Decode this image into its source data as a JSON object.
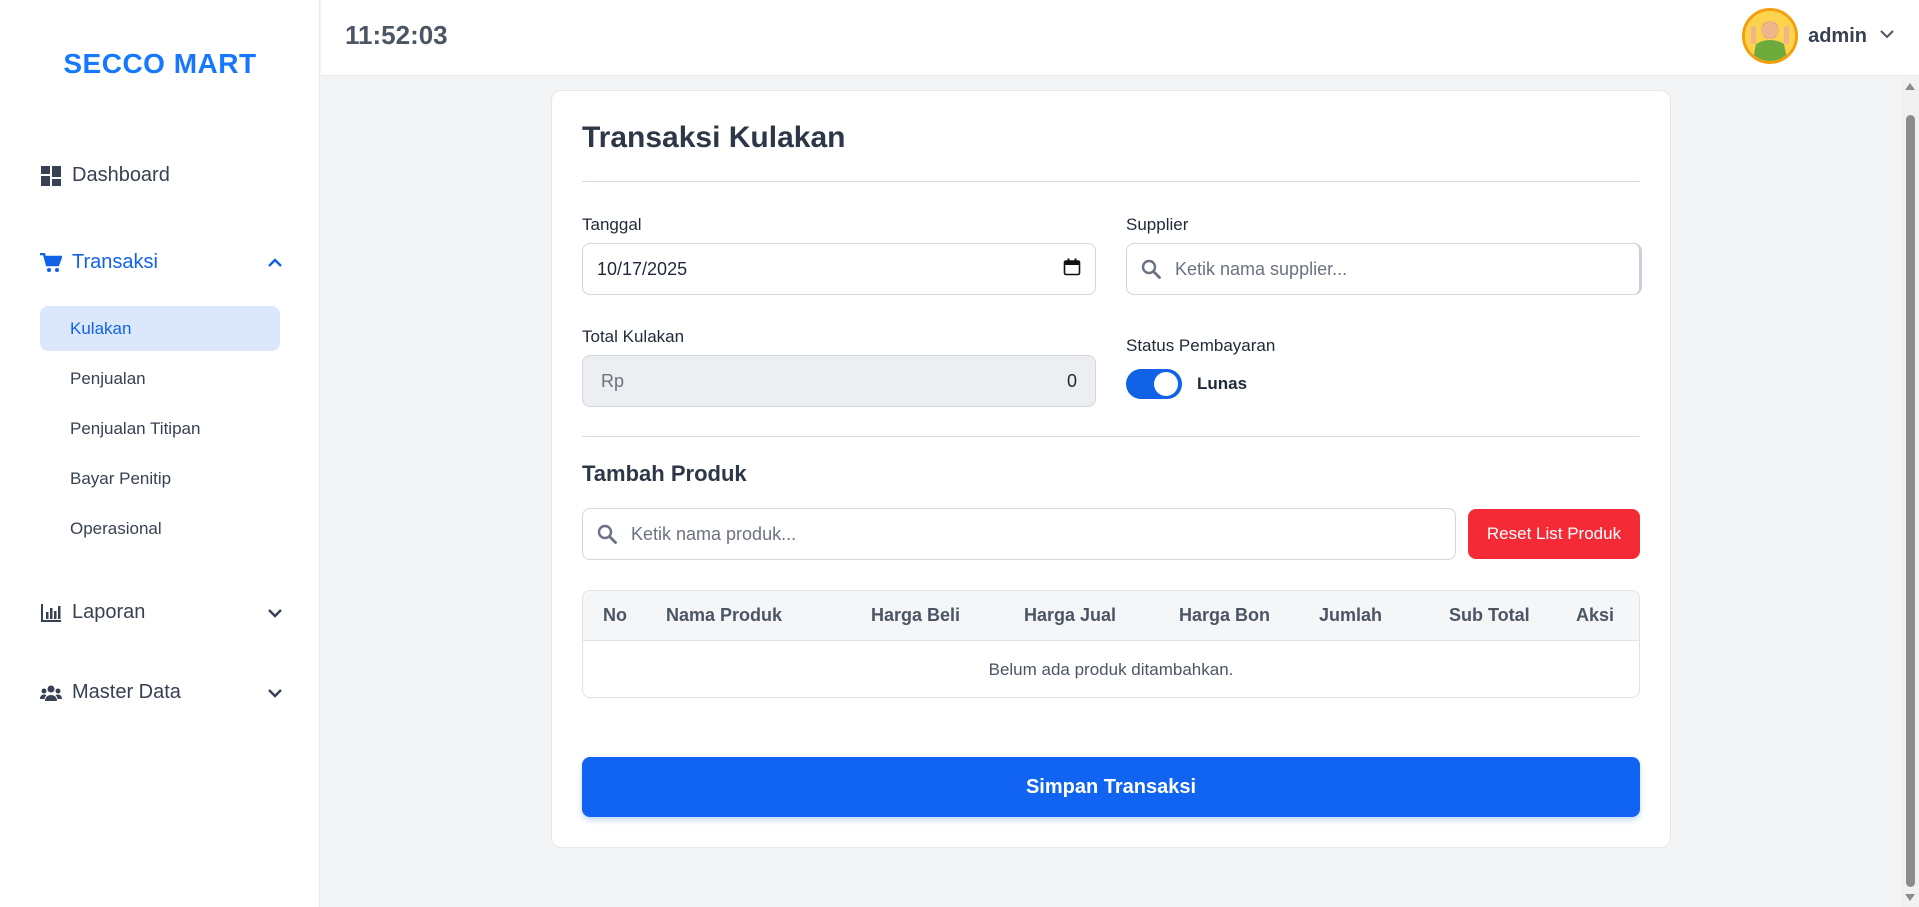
{
  "app": {
    "brand": "SECCO MART"
  },
  "topbar": {
    "clock": "11:52:03",
    "user_name": "admin"
  },
  "sidebar": {
    "dashboard": "Dashboard",
    "transaksi": "Transaksi",
    "sub_items": [
      "Kulakan",
      "Penjualan",
      "Penjualan Titipan",
      "Bayar Penitip",
      "Operasional"
    ],
    "laporan": "Laporan",
    "master_data": "Master Data"
  },
  "form": {
    "title": "Transaksi Kulakan",
    "tanggal_label": "Tanggal",
    "tanggal_value": "10/17/2025",
    "supplier_label": "Supplier",
    "supplier_placeholder": "Ketik nama supplier...",
    "total_label": "Total Kulakan",
    "total_prefix": "Rp",
    "total_value": "0",
    "status_label": "Status Pembayaran",
    "status_value": "Lunas",
    "status_on": true
  },
  "produk": {
    "title": "Tambah Produk",
    "search_placeholder": "Ketik nama produk...",
    "reset_label": "Reset List Produk",
    "columns": [
      "No",
      "Nama Produk",
      "Harga Beli",
      "Harga Jual",
      "Harga Bon",
      "Jumlah",
      "Sub Total",
      "Aksi"
    ],
    "empty_text": "Belum ada produk ditambahkan."
  },
  "save_label": "Simpan Transaksi",
  "colors": {
    "accent": "#1262e8",
    "danger": "#f42b37",
    "brand": "#1677ff"
  }
}
